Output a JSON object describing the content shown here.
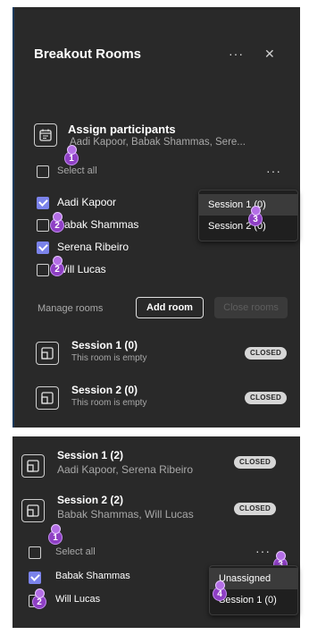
{
  "panel1": {
    "header": {
      "title": "Breakout Rooms",
      "more": "···",
      "close": "✕"
    },
    "assign": {
      "title": "Assign participants",
      "names": "Aadi Kapoor, Babak Shammas, Sere..."
    },
    "select_all": "Select all",
    "more": "···",
    "participants": [
      {
        "name": "Aadi Kapoor",
        "checked": true
      },
      {
        "name": "Babak Shammas",
        "checked": false
      },
      {
        "name": "Serena Ribeiro",
        "checked": true
      },
      {
        "name": "Will Lucas",
        "checked": false
      }
    ],
    "menu": [
      "Session 1 (0)",
      "Session 2 (0)"
    ],
    "manage_label": "Manage rooms",
    "add_room": "Add room",
    "close_rooms": "Close rooms",
    "rooms": [
      {
        "title": "Session 1 (0)",
        "sub": "This room is empty",
        "status": "CLOSED"
      },
      {
        "title": "Session 2 (0)",
        "sub": "This room is empty",
        "status": "CLOSED"
      }
    ],
    "markers": [
      "1",
      "2",
      "2",
      "3"
    ]
  },
  "panel2": {
    "rooms": [
      {
        "title": "Session 1 (2)",
        "sub": "Aadi Kapoor, Serena Ribeiro",
        "status": "CLOSED"
      },
      {
        "title": "Session 2 (2)",
        "sub": "Babak Shammas, Will Lucas",
        "status": "CLOSED"
      }
    ],
    "select_all": "Select all",
    "more": "···",
    "participants": [
      {
        "name": "Babak Shammas",
        "checked": true
      },
      {
        "name": "Will Lucas",
        "checked": false
      }
    ],
    "menu": [
      "Unassigned",
      "Session 1 (0)"
    ],
    "markers": [
      "1",
      "2",
      "3",
      "4"
    ]
  },
  "colors": {
    "panel": "#292929",
    "accent": "#7b83eb",
    "marker": "#8e3fc4"
  }
}
